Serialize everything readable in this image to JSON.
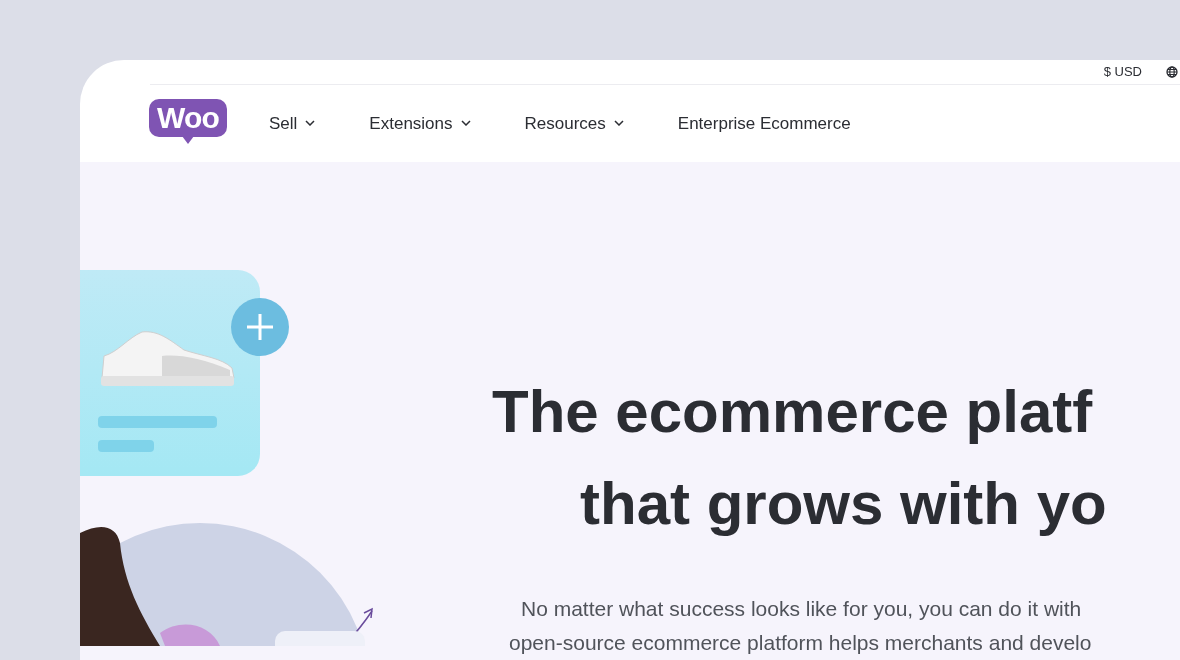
{
  "top_bar": {
    "currency": "$ USD"
  },
  "nav": {
    "logo": "Woo",
    "items": [
      {
        "label": "Sell",
        "has_menu": true
      },
      {
        "label": "Extensions",
        "has_menu": true
      },
      {
        "label": "Resources",
        "has_menu": true
      },
      {
        "label": "Enterprise Ecommerce",
        "has_menu": false
      }
    ]
  },
  "hero": {
    "headline": [
      "The ecommerce platf",
      "that grows with yo"
    ],
    "paragraph": [
      "No matter what success looks like for you, you can do it with",
      "open-source ecommerce platform helps merchants and develo"
    ]
  }
}
